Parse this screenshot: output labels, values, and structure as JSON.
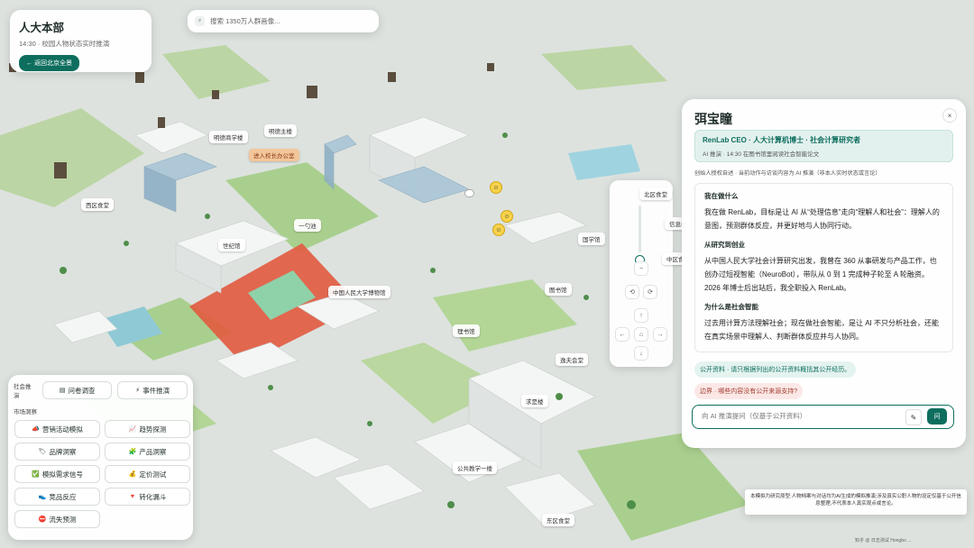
{
  "campus": {
    "title": "人大本部",
    "subtitle": "14:30 · 校园人物状态实时推演",
    "back_label": "← 返回北京全景"
  },
  "search": {
    "placeholder": "搜索 1350万人群画像..."
  },
  "map_labels": [
    {
      "id": "library-east",
      "text": "明德商学楼"
    },
    {
      "id": "mingde",
      "text": "明德主楼"
    },
    {
      "id": "office",
      "text": "进入校长办公室"
    },
    {
      "id": "west-canteen",
      "text": "西区食堂"
    },
    {
      "id": "yiyi",
      "text": "一勺池"
    },
    {
      "id": "shiji",
      "text": "世纪馆"
    },
    {
      "id": "museum",
      "text": "中国人民大学博物馆"
    },
    {
      "id": "guoxue",
      "text": "国学馆"
    },
    {
      "id": "beiqu",
      "text": "北区食堂"
    },
    {
      "id": "xinxi",
      "text": "信息楼"
    },
    {
      "id": "tushu",
      "text": "图书馆"
    },
    {
      "id": "zhongqu",
      "text": "中区食堂"
    },
    {
      "id": "lixin",
      "text": "理书馆"
    },
    {
      "id": "yifu",
      "text": "逸夫会堂"
    },
    {
      "id": "qiushi",
      "text": "求是楼"
    },
    {
      "id": "gonggong",
      "text": "公共教学一楼"
    },
    {
      "id": "dongqu",
      "text": "东区食堂"
    }
  ],
  "tools": {
    "social_label": "社会推演",
    "survey": "问卷调查",
    "event": "事件推演",
    "market_label": "市场洞察",
    "items": [
      {
        "icon": "📣",
        "label": "营销活动模拟"
      },
      {
        "icon": "📈",
        "label": "趋势探测"
      },
      {
        "icon": "🏷",
        "label": "品牌洞察"
      },
      {
        "icon": "🧩",
        "label": "产品洞察"
      },
      {
        "icon": "✅",
        "label": "模拟需求信号"
      },
      {
        "icon": "💰",
        "label": "定价测试"
      },
      {
        "icon": "👟",
        "label": "竞品反应"
      },
      {
        "icon": "🔻",
        "label": "转化漏斗"
      },
      {
        "icon": "⛔",
        "label": "流失预测"
      }
    ]
  },
  "zoom": {
    "minus": "−",
    "rot_left": "⟲",
    "rot_right": "⟳",
    "up": "↑",
    "left": "←",
    "home": "⌂",
    "right": "→",
    "down": "↓",
    "level": 0.28
  },
  "person": {
    "name": "弭宝瞳",
    "close": "×",
    "tag": "RenLab CEO · 人大计算机博士 · 社会计算研究者",
    "tag_sub": "AI 推演 · 14:30 在图书馆里阅读社会智能论文",
    "note": "创始人授权自述 · 当前动作与访谈内容为 AI 推演（非本人实时状态或言论）",
    "sections": [
      {
        "h": "我在做什么",
        "p": "我在做 RenLab，目标是让 AI 从“处理信息”走向“理解人和社会”：理解人的意图，预测群体反应，并更好地与人协同行动。"
      },
      {
        "h": "从研究到创业",
        "p": "从中国人民大学社会计算研究出发，我曾在 360 从事研发与产品工作，也创办过短视智能（NeuroBot），带队从 0 到 1 完成种子轮至 A 轮融资。2026 年博士后出站后，我全职投入 RenLab。"
      },
      {
        "h": "为什么是社会智能",
        "p": "过去用计算方法理解社会；现在做社会智能，是让 AI 不只分析社会，还能在真实场景中理解人、判断群体反应并与人协同。"
      }
    ],
    "chip1": "公开资料 · 请只根据列出的公开资料概括其公开经历。",
    "chip2": "边界 · 哪些内容没有公开来源支持?",
    "ask_placeholder": "向 AI 推演提问（仅基于公开资料）",
    "ask_button": "问",
    "pen": "✎"
  },
  "disclaimer": "本模拟为研究原型:人物档案与对话均为AI生成的模拟推演;涉及真实公职人物的设定仅基于公开信息整理,不代表本人真实观点或言论。",
  "credit": "知乎 @ 日志测试 Hongbo ...",
  "colors": {
    "accent": "#0e6e5e",
    "track": "#e25a3f"
  }
}
